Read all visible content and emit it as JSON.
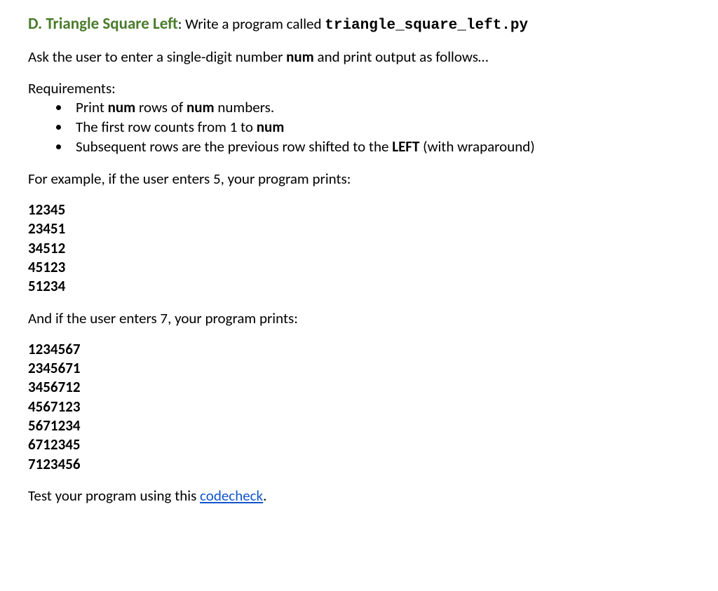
{
  "heading": {
    "label": "D. Triangle Square Left",
    "colon": ": ",
    "instruction_prefix": "Write a program called ",
    "filename": "triangle_square_left.py"
  },
  "intro": {
    "prefix": "Ask the user to enter a single-digit number ",
    "var": "num",
    "suffix": " and print output as follows…"
  },
  "requirements": {
    "header": "Requirements:",
    "items": [
      {
        "segments": [
          {
            "text": "Print ",
            "bold": false
          },
          {
            "text": "num",
            "bold": true
          },
          {
            "text": " rows of ",
            "bold": false
          },
          {
            "text": "num",
            "bold": true
          },
          {
            "text": " numbers.",
            "bold": false
          }
        ]
      },
      {
        "segments": [
          {
            "text": "The first row counts from 1 to ",
            "bold": false
          },
          {
            "text": "num",
            "bold": true
          }
        ]
      },
      {
        "segments": [
          {
            "text": "Subsequent rows are the previous row shifted to the ",
            "bold": false
          },
          {
            "text": "LEFT",
            "bold": true
          },
          {
            "text": " (with wraparound)",
            "bold": false
          }
        ]
      }
    ]
  },
  "example1": {
    "intro": "For example, if the user enters 5, your program prints:",
    "lines": [
      "12345",
      "23451",
      "34512",
      "45123",
      "51234"
    ]
  },
  "example2": {
    "intro": "And if the user enters 7, your program prints:",
    "lines": [
      "1234567",
      "2345671",
      "3456712",
      "4567123",
      "5671234",
      "6712345",
      "7123456"
    ]
  },
  "footer": {
    "prefix": "Test your program using this ",
    "link_text": "codecheck",
    "suffix": "."
  }
}
